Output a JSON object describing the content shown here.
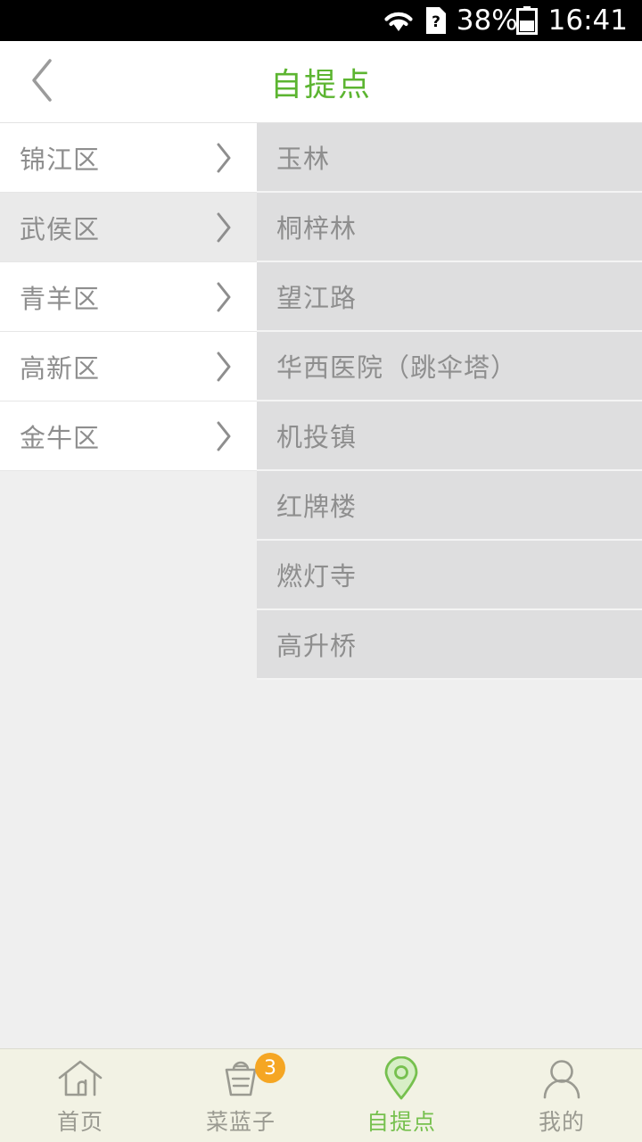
{
  "status_bar": {
    "battery_percent": "38%",
    "time": "16:41",
    "icons": [
      "wifi-icon",
      "sim-card-question-icon",
      "battery-icon"
    ]
  },
  "header": {
    "title": "自提点",
    "back_icon": "chevron-left-icon"
  },
  "districts": [
    {
      "label": "锦江区",
      "selected": false
    },
    {
      "label": "武侯区",
      "selected": true
    },
    {
      "label": "青羊区",
      "selected": false
    },
    {
      "label": "高新区",
      "selected": false
    },
    {
      "label": "金牛区",
      "selected": false
    }
  ],
  "stations": [
    {
      "label": "玉林"
    },
    {
      "label": "桐梓林"
    },
    {
      "label": "望江路"
    },
    {
      "label": "华西医院（跳伞塔）"
    },
    {
      "label": "机投镇"
    },
    {
      "label": "红牌楼"
    },
    {
      "label": "燃灯寺"
    },
    {
      "label": "高升桥"
    }
  ],
  "tabbar": {
    "items": [
      {
        "label": "首页",
        "icon": "home-icon",
        "active": false,
        "badge": ""
      },
      {
        "label": "菜蓝子",
        "icon": "basket-icon",
        "active": false,
        "badge": "3"
      },
      {
        "label": "自提点",
        "icon": "location-pin-icon",
        "active": true,
        "badge": ""
      },
      {
        "label": "我的",
        "icon": "person-icon",
        "active": false,
        "badge": ""
      }
    ]
  },
  "colors": {
    "accent_green": "#5cb531",
    "tab_active_green": "#76c04e",
    "badge_orange": "#f5a623",
    "station_row_bg": "#dededf",
    "selected_row_bg": "#eaeaea"
  }
}
